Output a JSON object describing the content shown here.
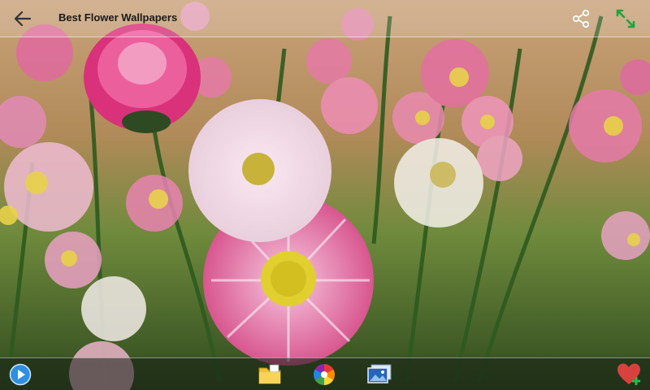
{
  "topbar": {
    "title": "Best Flower Wallpapers"
  },
  "icons": {
    "back": "arrow-left",
    "share": "share",
    "expand": "expand-arrows",
    "play": "play-circle",
    "folder": "folder",
    "color": "color-wheel",
    "gallery": "photo-stack",
    "favorite": "heart-plus"
  },
  "colors": {
    "accent_green": "#22a33a",
    "heart_red": "#d9413f",
    "play_blue": "#2f8fe0"
  }
}
